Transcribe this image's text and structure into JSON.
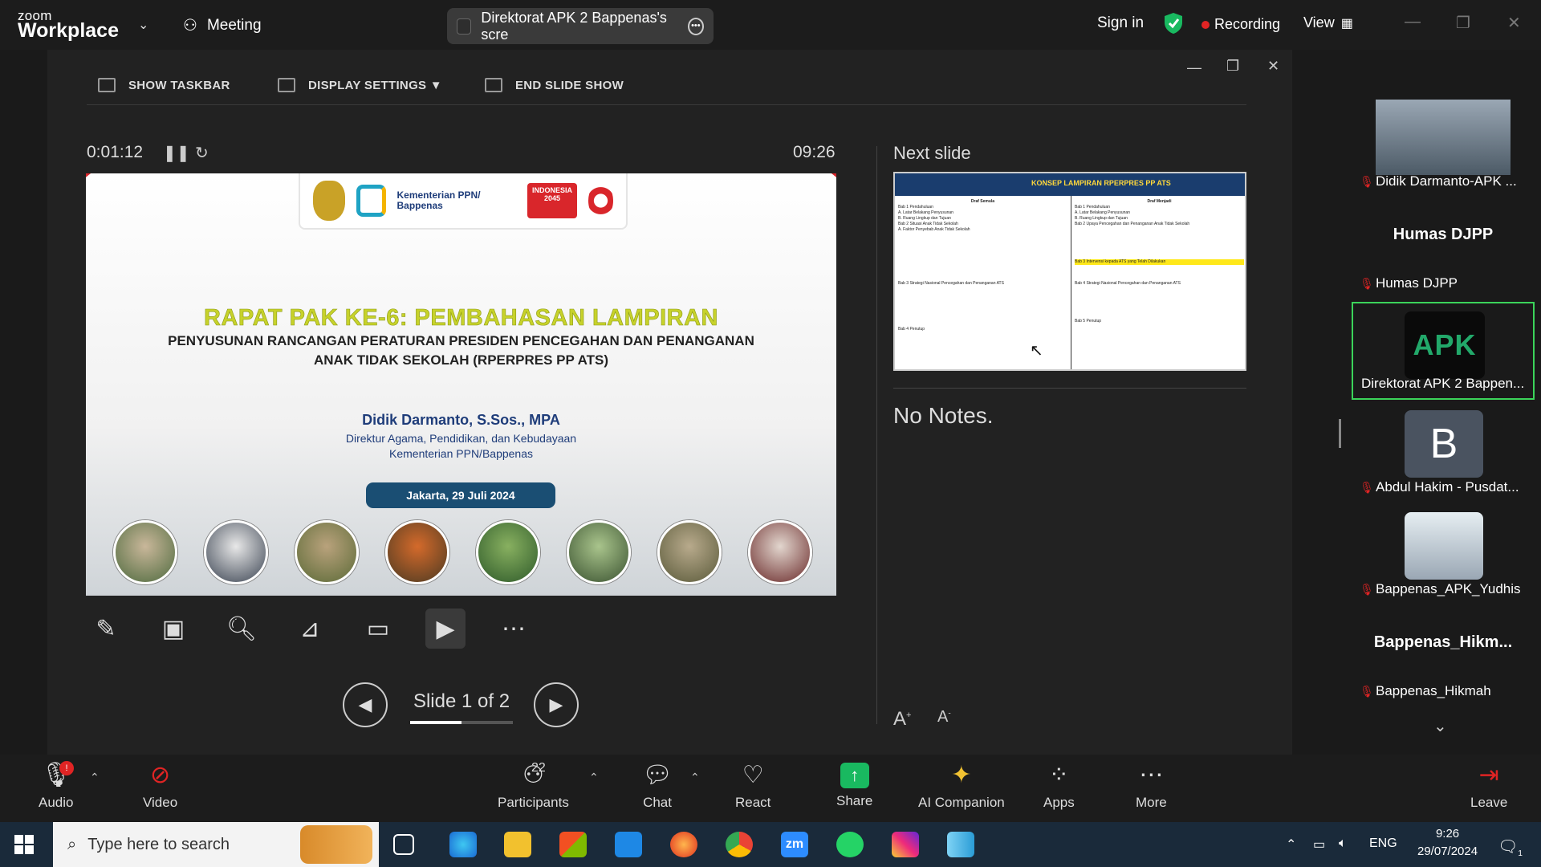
{
  "app": {
    "logo_small": "zoom",
    "logo_big": "Workplace",
    "meeting_label": "Meeting"
  },
  "share_pill": {
    "label": "Direktorat APK 2 Bappenas's scre"
  },
  "titlebar": {
    "signin": "Sign in",
    "recording": "Recording",
    "view": "View"
  },
  "presenter_toolbar": {
    "show_taskbar": "SHOW TASKBAR",
    "display_settings": "DISPLAY SETTINGS ▼",
    "end_slide_show": "END SLIDE SHOW"
  },
  "presenter": {
    "timer": "0:01:12",
    "clock": "09:26",
    "next_slide_label": "Next slide",
    "notes": "No Notes.",
    "slide_count": "Slide 1 of 2"
  },
  "slide": {
    "logo_ministry": "Kementerian PPN/ Bappenas",
    "logo_indonesia": "INDONESIA 2045",
    "logo_asean": "ASEAN INDONESIA 2023",
    "title": "RAPAT PAK KE-6: PEMBAHASAN LAMPIRAN",
    "subtitle": "PENYUSUNAN RANCANGAN PERATURAN PRESIDEN PENCEGAHAN DAN PENANGANAN ANAK TIDAK SEKOLAH (RPERPRES PP ATS)",
    "presenter_name": "Didik Darmanto, S.Sos., MPA",
    "presenter_role": "Direktur Agama, Pendidikan, dan Kebudayaan",
    "presenter_org": "Kementerian PPN/Bappenas",
    "date": "Jakarta, 29 Juli 2024"
  },
  "next_slide": {
    "title": "KONSEP LAMPIRAN RPERPRES PP ATS",
    "col1_header": "Draf Semula",
    "col2_header": "Draf Menjadi",
    "col1_lines": [
      "Bab 1 Pendahuluan",
      "A. Latar Belakang Penyusunan",
      "B. Ruang Lingkup dan Tujuan",
      "Bab 2 Situasi Anak Tidak Sekolah",
      "A. Faktor Penyebab Anak Tidak Sekolah",
      "Bab 3 Strategi Nasional Pencegahan dan Penanganan ATS",
      "Bab 4 Penutup"
    ],
    "col2_lines": [
      "Bab 1 Pendahuluan",
      "A. Latar Belakang Penyusunan",
      "B. Ruang Lingkup dan Tujuan",
      "Bab 2 Upaya Pencegahan dan Penanganan Anak Tidak Sekolah",
      "Bab 3 Intervensi kepada ATS yang Telah Dilakukan",
      "Bab 4 Strategi Nasional Pencegahan dan Penanganan ATS",
      "Bab 5 Penutup"
    ]
  },
  "gallery": {
    "tiles": [
      {
        "name": "Didik Darmanto-APK ...",
        "big": ""
      },
      {
        "name": "Humas DJPP",
        "big": "Humas DJPP"
      },
      {
        "name": "Direktorat APK 2 Bappen...",
        "big": "",
        "logo": "APK"
      },
      {
        "name": "Abdul Hakim - Pusdat...",
        "big": "",
        "avatar": "B"
      },
      {
        "name": "Bappenas_APK_Yudhis",
        "big": ""
      },
      {
        "name": "Bappenas_Hikmah",
        "big": "Bappenas_Hikm..."
      }
    ]
  },
  "toolbar": {
    "audio": "Audio",
    "audio_badge": "!",
    "video": "Video",
    "participants": "Participants",
    "participants_count": "22",
    "chat": "Chat",
    "react": "React",
    "share": "Share",
    "ai": "AI Companion",
    "apps": "Apps",
    "more": "More",
    "leave": "Leave"
  },
  "taskbar": {
    "search_placeholder": "Type here to search",
    "lang": "ENG",
    "time": "9:26",
    "date": "29/07/2024",
    "notif_count": "1"
  },
  "colors": {
    "accent_green": "#3bd45a",
    "recording_red": "#e02424",
    "share_green": "#19b960",
    "slide_title": "#c7d22b"
  }
}
